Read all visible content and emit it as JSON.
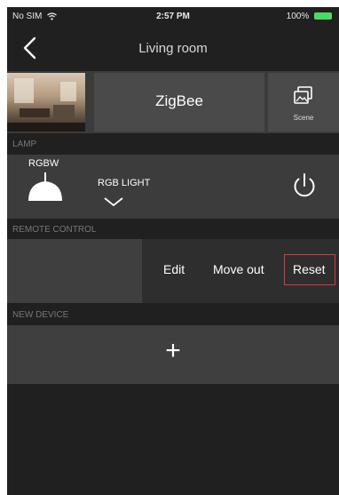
{
  "status_bar": {
    "carrier": "No SIM",
    "time": "2:57 PM",
    "battery": "100%"
  },
  "nav": {
    "title": "Living room"
  },
  "room": {
    "gateway": "ZigBee",
    "scene_label": "Scene"
  },
  "lamp_section": {
    "header": "LAMP",
    "device": {
      "type_label": "RGBW",
      "name": "RGB LIGHT"
    }
  },
  "remote_section": {
    "header": "REMOTE CONTROL",
    "actions": {
      "edit": "Edit",
      "move_out": "Move out",
      "reset": "Reset"
    }
  },
  "new_device_section": {
    "header": "NEW DEVICE",
    "add_symbol": "+"
  },
  "colors": {
    "background": "#202020",
    "card": "#3c3c3c",
    "highlight": "#d83a3a",
    "battery": "#4cd964"
  }
}
